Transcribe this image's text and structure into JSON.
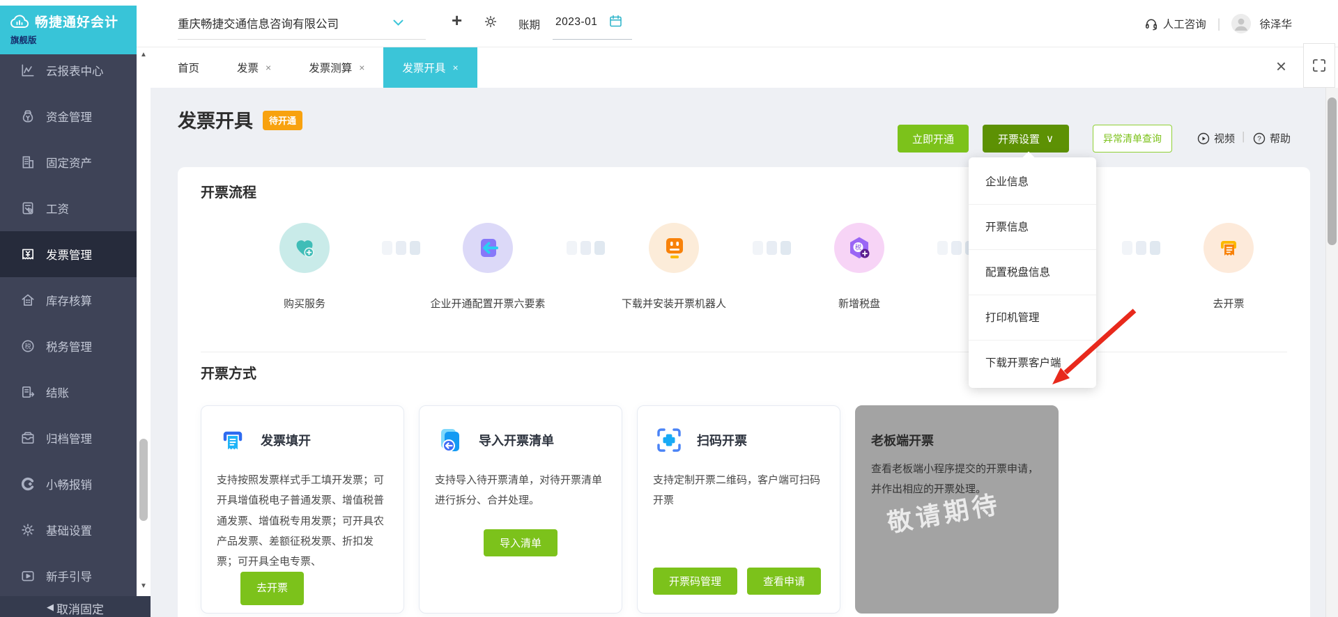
{
  "ui": {
    "plus_glyph": "+",
    "close_glyph": "×",
    "scroll_up_glyph": "▲",
    "scroll_down_glyph": "▼",
    "collapse_glyph": "◀",
    "collapse_bars_glyph": "▌▌",
    "divider_glyph": "|",
    "dropdown_arrow_glyph": "∨"
  },
  "header": {
    "logo_title": "畅捷通好会计",
    "logo_badge": "旗舰版",
    "company_name": "重庆畅捷交通信息咨询有限公司",
    "period_label": "账期",
    "period_value": "2023-01",
    "support_label": "人工咨询",
    "user_name": "徐泽华"
  },
  "tabs": [
    {
      "label": "首页"
    },
    {
      "label": "发票"
    },
    {
      "label": "发票测算"
    },
    {
      "label": "发票开具"
    }
  ],
  "sidebar": {
    "items": [
      {
        "label": "云报表中心"
      },
      {
        "label": "资金管理"
      },
      {
        "label": "固定资产"
      },
      {
        "label": "工资"
      },
      {
        "label": "发票管理"
      },
      {
        "label": "库存核算"
      },
      {
        "label": "税务管理"
      },
      {
        "label": "结账"
      },
      {
        "label": "归档管理"
      },
      {
        "label": "小畅报销"
      },
      {
        "label": "基础设置"
      },
      {
        "label": "新手引导"
      }
    ],
    "footer_label": "取消固定"
  },
  "page": {
    "title": "发票开具",
    "status_badge": "待开通",
    "actions": {
      "activate": "立即开通",
      "settings": "开票设置",
      "abnormal": "异常清单查询",
      "video": "视频",
      "help": "帮助"
    },
    "settings_menu": [
      {
        "label": "企业信息"
      },
      {
        "label": "开票信息"
      },
      {
        "label": "配置税盘信息"
      },
      {
        "label": "打印机管理"
      },
      {
        "label": "下载开票客户端"
      }
    ]
  },
  "flow": {
    "title": "开票流程",
    "steps": [
      {
        "label": "购买服务",
        "icon": "heart-plus-icon"
      },
      {
        "label": "企业开通配置开票六要素",
        "icon": "config-import-icon"
      },
      {
        "label": "下载并安装开票机器人",
        "icon": "robot-icon"
      },
      {
        "label": "新增税盘",
        "icon": "tax-disk-plus-icon"
      },
      {
        "label": "去开票",
        "icon": "invoice-printer-icon"
      }
    ]
  },
  "methods": {
    "title": "开票方式",
    "cards": [
      {
        "title": "发票填开",
        "desc": "支持按照发票样式手工填开发票；可开具增值税电子普通发票、增值税普通发票、增值税专用发票；可开具农产品发票、差额征税发票、折扣发票；可开具全电专票、",
        "button": "去开票",
        "icon": "invoice-fill-icon"
      },
      {
        "title": "导入开票清单",
        "desc": "支持导入待开票清单，对待开票清单进行拆分、合并处理。",
        "button": "导入清单",
        "icon": "import-list-icon"
      },
      {
        "title": "扫码开票",
        "desc": "支持定制开票二维码，客户端可扫码开票",
        "button1": "开票码管理",
        "button2": "查看申请",
        "icon": "scan-qr-icon"
      },
      {
        "title": "老板端开票",
        "desc": "查看老板端小程序提交的开票申请，并作出相应的开票处理。",
        "watermark": "敬请期待"
      }
    ]
  },
  "colors": {
    "brand_cyan": "#3bc5d8",
    "primary_green": "#7cc21b",
    "dark_green": "#5d9104",
    "badge_orange": "#f8a20f",
    "sidebar_bg": "#3e4357",
    "sidebar_active_bg": "#262b3b",
    "content_bg": "#eef0f4",
    "disabled_card_gray": "#a3a3a3",
    "annotation_red": "#e8291c"
  }
}
